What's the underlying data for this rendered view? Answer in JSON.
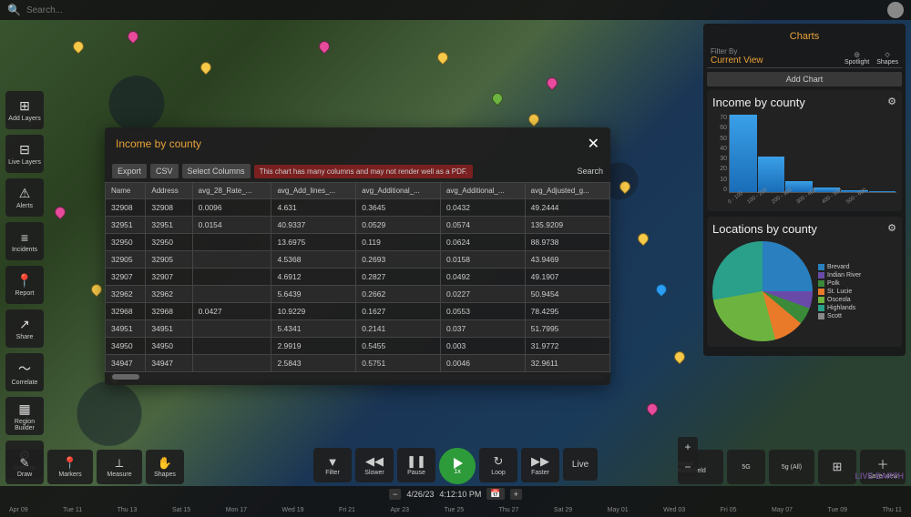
{
  "search": {
    "placeholder": "Search..."
  },
  "sidebar": [
    {
      "icon": "⊞",
      "label": "Add Layers"
    },
    {
      "icon": "⊟",
      "label": "Live Layers"
    },
    {
      "icon": "⚠",
      "label": "Alerts"
    },
    {
      "icon": "≡",
      "label": "Incidents"
    },
    {
      "icon": "📍",
      "label": "Report",
      "y": true
    },
    {
      "icon": "↗",
      "label": "Share"
    },
    {
      "icon": "〜",
      "label": "Correlate"
    },
    {
      "icon": "▦",
      "label": "Region Builder"
    },
    {
      "icon": "⚙",
      "label": "Settings"
    }
  ],
  "tools_left": [
    {
      "icon": "✎",
      "label": "Draw"
    },
    {
      "icon": "📍",
      "label": "Markers"
    },
    {
      "icon": "⟂",
      "label": "Measure"
    },
    {
      "icon": "✋",
      "label": "Shapes"
    }
  ],
  "tools_center": [
    {
      "icon": "▼",
      "label": "Filter"
    },
    {
      "icon": "◀◀",
      "label": "Slower"
    },
    {
      "icon": "❚❚",
      "label": "Pause"
    }
  ],
  "play_speed": "1x",
  "tools_center2": [
    {
      "icon": "↻",
      "label": "Loop"
    },
    {
      "icon": "▶▶",
      "label": "Faster"
    }
  ],
  "live_label": "Live",
  "tools_right": [
    {
      "icon": "",
      "label": "Retail Battlefield"
    },
    {
      "icon": "",
      "label": "5G"
    },
    {
      "icon": "",
      "label": "5g (All)"
    },
    {
      "icon": "⊞",
      "label": ""
    },
    {
      "icon": "＋",
      "label": "Save View"
    }
  ],
  "timeline": {
    "minus": "−",
    "date": "4/26/23",
    "time": "4:12:10 PM",
    "cal": "📅",
    "plus": "+",
    "ticks": [
      "Apr 09",
      "Tue 11",
      "Thu 13",
      "Sat 15",
      "Mon 17",
      "Wed 19",
      "Fri 21",
      "Apr 23",
      "Tue 25",
      "Thu 27",
      "Sat 29",
      "May 01",
      "Wed 03",
      "Fri 05",
      "May 07",
      "Tue 09",
      "Thu 11"
    ]
  },
  "modal": {
    "title": "Income by county",
    "export": "Export",
    "csv": "CSV",
    "select_cols": "Select Columns",
    "warning": "This chart has many columns and may not render well as a PDF.",
    "search": "Search",
    "columns": [
      "Name",
      "Address",
      "avg_28_Rate_...",
      "avg_Add_lines_...",
      "avg_Additional_...",
      "avg_Additional_...",
      "avg_Adjusted_g..."
    ],
    "rows": [
      [
        "32908",
        "32908",
        "0.0096",
        "4.631",
        "0.3645",
        "0.0432",
        "49.2444"
      ],
      [
        "32951",
        "32951",
        "0.0154",
        "40.9337",
        "0.0529",
        "0.0574",
        "135.9209"
      ],
      [
        "32950",
        "32950",
        "",
        "13.6975",
        "0.119",
        "0.0624",
        "88.9738"
      ],
      [
        "32905",
        "32905",
        "",
        "4.5368",
        "0.2693",
        "0.0158",
        "43.9469"
      ],
      [
        "32907",
        "32907",
        "",
        "4.6912",
        "0.2827",
        "0.0492",
        "49.1907"
      ],
      [
        "32962",
        "32962",
        "",
        "5.6439",
        "0.2662",
        "0.0227",
        "50.9454"
      ],
      [
        "32968",
        "32968",
        "0.0427",
        "10.9229",
        "0.1627",
        "0.0553",
        "78.4295"
      ],
      [
        "34951",
        "34951",
        "",
        "5.4341",
        "0.2141",
        "0.037",
        "51.7995"
      ],
      [
        "34950",
        "34950",
        "",
        "2.9919",
        "0.5455",
        "0.003",
        "31.9772"
      ],
      [
        "34947",
        "34947",
        "",
        "2.5843",
        "0.5751",
        "0.0046",
        "32.9611"
      ]
    ]
  },
  "charts_panel": {
    "header": "Charts",
    "filter_label": "Filter By",
    "filter_value": "Current View",
    "icon_spotlight": "Spotlight",
    "icon_shapes": "Shapes",
    "add_chart": "Add Chart"
  },
  "chart_data": [
    {
      "type": "bar",
      "title": "Income by county",
      "categories": [
        "0 - 100",
        "100 - 200",
        "200 - 300",
        "300 - 400",
        "400 - 500",
        "500 - 600"
      ],
      "values": [
        70,
        32,
        10,
        4,
        2,
        1
      ],
      "ylim": [
        0,
        70
      ],
      "yticks": [
        0,
        10,
        20,
        30,
        40,
        50,
        60,
        70
      ]
    },
    {
      "type": "pie",
      "title": "Locations by county",
      "series": [
        {
          "name": "Brevard",
          "value": 25,
          "color": "#2a7fbf"
        },
        {
          "name": "Indian River",
          "value": 6,
          "color": "#6a4aa8"
        },
        {
          "name": "Polk",
          "value": 6,
          "color": "#3a8a3a"
        },
        {
          "name": "St. Lucie",
          "value": 10,
          "color": "#e87a2a"
        },
        {
          "name": "Osceola",
          "value": 26,
          "color": "#6db33f"
        },
        {
          "name": "Highlands",
          "value": 27,
          "color": "#2a9f8a"
        },
        {
          "name": "Scott",
          "value": 0,
          "color": "#888"
        }
      ]
    }
  ],
  "logo": "LIVE EARTH"
}
